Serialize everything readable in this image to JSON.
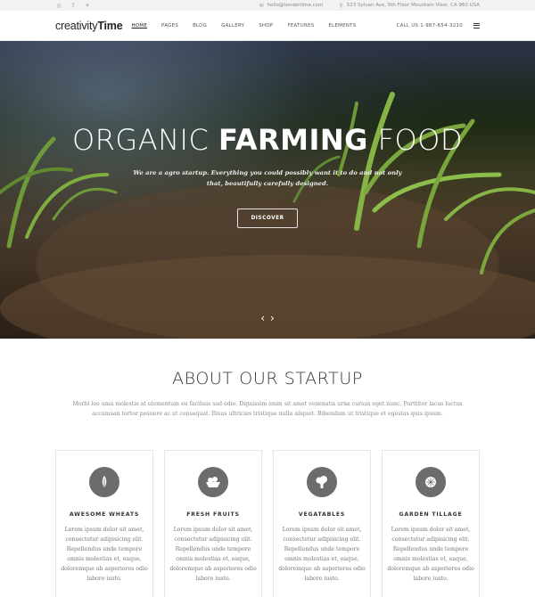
{
  "topbar": {
    "social": [
      {
        "icon": "instagram-icon",
        "glyph": "◎"
      },
      {
        "icon": "facebook-icon",
        "glyph": "f"
      },
      {
        "icon": "twitter-icon",
        "glyph": "✈"
      }
    ],
    "email": "hello@tendertime.com",
    "address": "523 Sylvan Ave, 5th Floor Mountain View, CA 960 USA"
  },
  "header": {
    "logo_light": "creativity",
    "logo_bold": "Time",
    "nav": [
      "HOME",
      "PAGES",
      "BLOG",
      "GALLERY",
      "SHOP",
      "FEATURES",
      "ELEMENTS"
    ],
    "call": "CALL US 1-987-654-3210"
  },
  "hero": {
    "title_pre": "ORGANIC ",
    "title_bold": "FARMING",
    "title_post": " FOOD",
    "subtitle": "We are a agro startup. Everything you could possibly want it to do and not only that, beautifully carefully designed.",
    "button": "DISCOVER"
  },
  "about": {
    "title": "ABOUT OUR STARTUP",
    "text": "Morbi leo uma molestie at elementum eu facilisis sed odio. Dignissim enim sit amet venenatis urna cursus eget nunc. Porttitor lacus luctus accumsan tortor posuere ac ut consequat. Risus ultricies tristique nulla aliquet. Bibendum ut tristique et egestas quis ipsum."
  },
  "features": [
    {
      "title": "AWESOME WHEATS",
      "icon": "wheat-icon",
      "text": "Lorem ipsum dolor sit amet, consectetur adipisicing elit. Repellendus unde tempore omnis molestias et, eaque, doloremque ab asperiores odio labore iusto."
    },
    {
      "title": "FRESH FRUITS",
      "icon": "fruit-basket-icon",
      "text": "Lorem ipsum dolor sit amet, consectetur adipisicing elit. Repellendus unde tempore omnis molestias et, eaque, doloremque ab asperiores odio labore iusto."
    },
    {
      "title": "VEGATABLES",
      "icon": "broccoli-icon",
      "text": "Lorem ipsum dolor sit amet, consectetur adipisicing elit. Repellendus unde tempore omnis molestias et, eaque, doloremque ab asperiores odio labore iusto."
    },
    {
      "title": "GARDEN TILLAGE",
      "icon": "plant-icon",
      "text": "Lorem ipsum dolor sit amet, consectetur adipisicing elit. Repellendus unde tempore omnis molestias et, eaque, doloremque ab asperiores odio labore iusto."
    }
  ]
}
